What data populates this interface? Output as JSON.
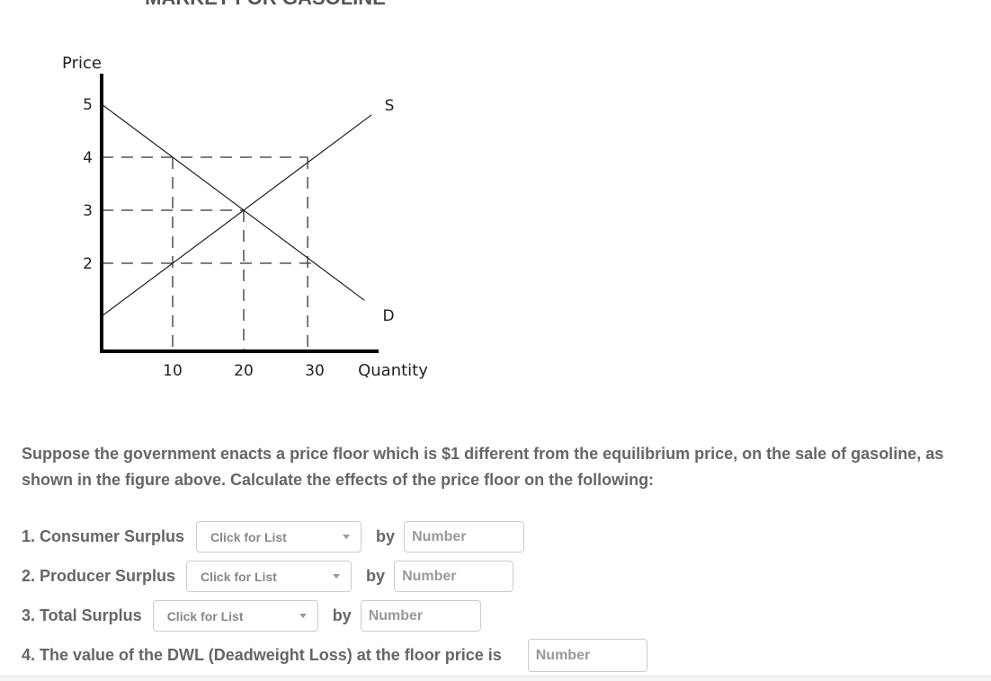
{
  "chart_data": {
    "type": "line",
    "title": "MARKET FOR GASOLINE",
    "xlabel": "Quantity",
    "ylabel": "Price",
    "x_ticks": [
      10,
      20,
      30
    ],
    "y_ticks": [
      2,
      3,
      4,
      5
    ],
    "xlim": [
      0,
      38
    ],
    "ylim": [
      0,
      5.5
    ],
    "grid": false,
    "series": [
      {
        "name": "D",
        "points": [
          [
            0,
            5
          ],
          [
            10,
            4
          ],
          [
            20,
            3
          ],
          [
            30,
            2
          ],
          [
            37,
            1.3
          ]
        ]
      },
      {
        "name": "S",
        "points": [
          [
            0,
            1
          ],
          [
            10,
            2
          ],
          [
            20,
            3
          ],
          [
            30,
            4
          ],
          [
            38,
            4.8
          ]
        ]
      }
    ],
    "guides": [
      {
        "type": "h",
        "y": 4,
        "x_to": 29
      },
      {
        "type": "h",
        "y": 3,
        "x_to": 20
      },
      {
        "type": "h",
        "y": 2,
        "x_to": 30
      },
      {
        "type": "v",
        "x": 10,
        "y_to": 4
      },
      {
        "type": "v",
        "x": 20,
        "y_to": 3
      },
      {
        "type": "v",
        "x": 29,
        "y_to": 4
      }
    ]
  },
  "question": {
    "text": "Suppose the government enacts a price floor which is $1 different from the equilibrium price, on the sale of gasoline, as shown in the figure above. Calculate the effects of the price floor on the following:"
  },
  "items": [
    {
      "label": "1. Consumer Surplus",
      "select": "Click for List",
      "by": "by",
      "placeholder": "Number"
    },
    {
      "label": "2. Producer Surplus",
      "select": "Click for List",
      "by": "by",
      "placeholder": "Number"
    },
    {
      "label": "3. Total Surplus",
      "select": "Click for List",
      "by": "by",
      "placeholder": "Number"
    },
    {
      "label": "4. The value of the DWL (Deadweight Loss) at the floor price is",
      "placeholder": "Number"
    }
  ]
}
